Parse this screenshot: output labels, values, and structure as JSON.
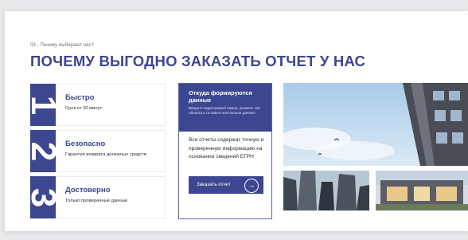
{
  "section": {
    "eyebrow": "03 - Почему выбирают нас?",
    "title": "ПОЧЕМУ ВЫГОДНО ЗАКАЗАТЬ ОТЧЕТ У НАС"
  },
  "benefits": [
    {
      "num": "1",
      "title": "Быстро",
      "subtitle": "Срок от 30 минут"
    },
    {
      "num": "2",
      "title": "Безопасно",
      "subtitle": "Гарантия возврата денежных средств"
    },
    {
      "num": "3",
      "title": "Достоверно",
      "subtitle": "Только проверенные данные"
    }
  ],
  "source_card": {
    "title": "Откуда формируются данные",
    "hint": "Введите кадастровый номер, укажите тип объекта и оставьте контактные данные",
    "body": "Все отчеты содержат точную и проверенную информацию на основании сведений ЕГРН",
    "button": "Заказать отчет",
    "button_icon": "arrow-right-icon"
  },
  "colors": {
    "brand": "#3d4690",
    "background": "#ffffff"
  }
}
